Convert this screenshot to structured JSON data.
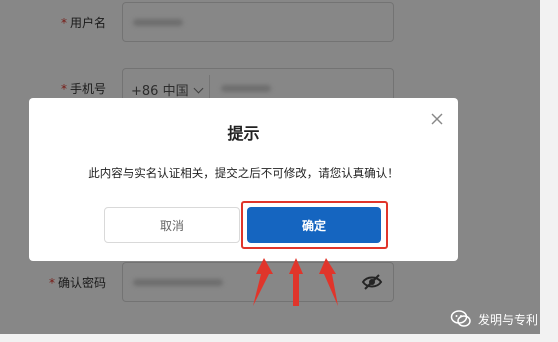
{
  "form": {
    "username_label": "用户名",
    "phone_label": "手机号",
    "phone_prefix": "+86 中国",
    "confirm_password_label": "确认密码",
    "required_mark": "*"
  },
  "dialog": {
    "title": "提示",
    "message": "此内容与实名认证相关，提交之后不可修改，请您认真确认！",
    "cancel_label": "取消",
    "confirm_label": "确定"
  },
  "watermark": {
    "text": "发明与专利"
  },
  "colors": {
    "primary": "#1565c0",
    "annotation_red": "#e0352b",
    "overlay": "rgba(0,0,0,0.47)"
  }
}
